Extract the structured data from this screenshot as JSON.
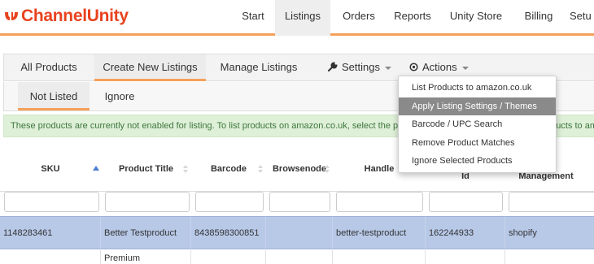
{
  "app": {
    "name": "ChannelUnity",
    "brand_color": "#e8431f",
    "accent_color": "#f5a05a"
  },
  "nav": {
    "items": [
      {
        "label": "Start"
      },
      {
        "label": "Listings",
        "active": true
      },
      {
        "label": "Orders"
      },
      {
        "label": "Reports"
      },
      {
        "label": "Unity Store"
      },
      {
        "label": "Billing"
      },
      {
        "label": "Setu"
      }
    ]
  },
  "subnav": {
    "tabs": [
      {
        "label": "All Products"
      },
      {
        "label": "Create New Listings",
        "active": true
      },
      {
        "label": "Manage Listings"
      }
    ],
    "settings_label": "Settings",
    "settings_icon": "wrench-icon",
    "actions_label": "Actions",
    "actions_icon": "circle-dot-icon"
  },
  "subtabs": [
    {
      "label": "Not Listed",
      "active": true
    },
    {
      "label": "Ignore"
    }
  ],
  "banner": {
    "text": "These products are currently not enabled for listing. To list products on amazon.co.uk, select the products and choose Actions -> List Products to amazon.co.uk"
  },
  "actions_menu": {
    "items": [
      {
        "label": "List Products to amazon.co.uk"
      },
      {
        "label": "Apply Listing Settings / Themes",
        "hovered": true
      },
      {
        "label": "Barcode / UPC Search"
      },
      {
        "label": "Remove Product Matches"
      },
      {
        "label": "Ignore Selected Products"
      }
    ]
  },
  "table": {
    "columns": [
      "SKU",
      "Product Title",
      "Barcode",
      "Browsenode",
      "Handle",
      "Id",
      "ory Management"
    ],
    "rows": [
      [
        "1148283461",
        "Better Testproduct",
        "8438598300851",
        "",
        "better-testproduct",
        "162244933",
        "shopify"
      ],
      [
        "",
        "Premium",
        "",
        "",
        "",
        "",
        ""
      ]
    ]
  }
}
